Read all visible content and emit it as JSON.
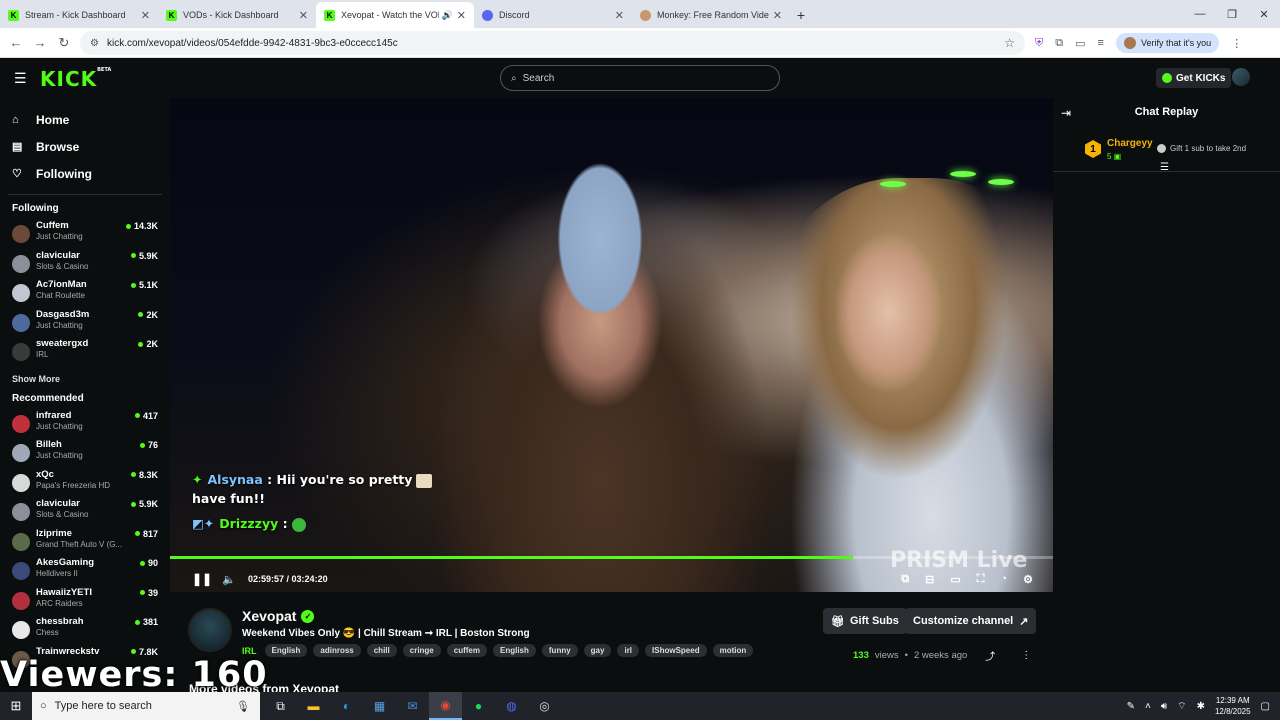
{
  "browser": {
    "tabs": [
      {
        "title": "Stream - Kick Dashboard",
        "icon": "kick-favicon",
        "active": false
      },
      {
        "title": "VODs - Kick Dashboard",
        "icon": "kick-favicon",
        "active": false
      },
      {
        "title": "Xevopat - Watch the VOD o",
        "icon": "kick-favicon",
        "active": true
      },
      {
        "title": "Discord",
        "icon": "discord-favicon",
        "active": false
      },
      {
        "title": "Monkey: Free Random Video C",
        "icon": "monkey-favicon",
        "active": false
      }
    ],
    "url": "kick.com/xevopat/videos/054efdde-9942-4831-9bc3-e0ccecc145c",
    "verify_label": "Verify that it's you"
  },
  "kick": {
    "logo": "KICK",
    "logo_badge": "BETA",
    "search_placeholder": "Search",
    "get_kicks": "Get KICKs",
    "accent": "#53fc18"
  },
  "sidebar": {
    "nav": [
      {
        "label": "Home",
        "icon": "home-icon"
      },
      {
        "label": "Browse",
        "icon": "browse-icon"
      },
      {
        "label": "Following",
        "icon": "heart-icon"
      }
    ],
    "following_title": "Following",
    "following": [
      {
        "name": "Cuffem",
        "category": "Just Chatting",
        "viewers": "14.3K",
        "color": "#6b4a3a"
      },
      {
        "name": "clavicular",
        "category": "Slots & Casino",
        "viewers": "5.9K",
        "color": "#8a8f99"
      },
      {
        "name": "Ac7ionMan",
        "category": "Chat Roulette",
        "viewers": "5.1K",
        "color": "#c0c6d2"
      },
      {
        "name": "Dasgasd3m",
        "category": "Just Chatting",
        "viewers": "2K",
        "color": "#4f6a9a"
      },
      {
        "name": "sweatergxd",
        "category": "IRL",
        "viewers": "2K",
        "color": "#3a3a3a"
      }
    ],
    "show_more": "Show More",
    "recommended_title": "Recommended",
    "recommended": [
      {
        "name": "infrared",
        "category": "Just Chatting",
        "viewers": "417",
        "color": "#c0303a"
      },
      {
        "name": "Billeh",
        "category": "Just Chatting",
        "viewers": "76",
        "color": "#a0a8b8"
      },
      {
        "name": "xQc",
        "category": "Papa's Freezeria HD",
        "viewers": "8.3K",
        "color": "#d8d8d8"
      },
      {
        "name": "clavicular",
        "category": "Slots & Casino",
        "viewers": "5.9K",
        "color": "#8a8f99"
      },
      {
        "name": "lziprime",
        "category": "Grand Theft Auto V (G...",
        "viewers": "817",
        "color": "#5a6a4a"
      },
      {
        "name": "AkesGaming",
        "category": "Helldivers II",
        "viewers": "90",
        "color": "#3a4a7a"
      },
      {
        "name": "HawaiizYETI",
        "category": "ARC Raiders",
        "viewers": "39",
        "color": "#b03040"
      },
      {
        "name": "chessbrah",
        "category": "Chess",
        "viewers": "381",
        "color": "#e8e8e8"
      },
      {
        "name": "Trainwreckstv",
        "category": "",
        "viewers": "7.8K",
        "color": "#6a5a4a"
      }
    ]
  },
  "video": {
    "chat_overlay": [
      {
        "user": "Alsynaa",
        "message": "Hii you're so pretty",
        "message2": "have fun!!"
      },
      {
        "user": "Drizzzyy",
        "message": ""
      }
    ],
    "watermark": "PRISM Live",
    "progress": 0.774,
    "time_current": "02:59:57",
    "time_total": "03:24:20"
  },
  "channel": {
    "name": "Xevopat",
    "title": "Weekend Vibes Only 😎 | Chill Stream ➞ IRL | Boston Strong",
    "category": "IRL",
    "tags": [
      "English",
      "adinross",
      "chill",
      "cringe",
      "cuffem",
      "English",
      "funny",
      "gay",
      "irl",
      "IShowSpeed",
      "motion"
    ],
    "gift_subs": "Gift Subs",
    "customize": "Customize channel",
    "views_count": "133",
    "views_label": "views",
    "posted": "2 weeks ago",
    "more_videos": "More videos from Xevopat"
  },
  "chat_replay": {
    "title": "Chat Replay",
    "top_gifter": {
      "rank": "1",
      "name": "Chargeyy",
      "count": "5",
      "cta": "Gift 1 sub to take 2nd"
    }
  },
  "overlay": {
    "viewers_text": "Viewers: 160"
  },
  "taskbar": {
    "search_placeholder": "Type here to search",
    "time": "12:39 AM",
    "date": "12/8/2025"
  }
}
